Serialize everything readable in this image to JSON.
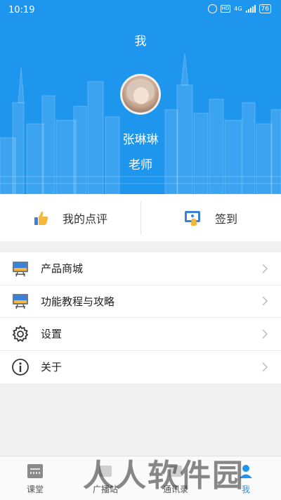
{
  "status_bar": {
    "time": "10:19",
    "hd": "HD",
    "network": "4G",
    "battery": "76"
  },
  "header": {
    "title": "我"
  },
  "profile": {
    "name": "张琳琳",
    "role": "老师"
  },
  "actions": [
    {
      "label": "我的点评",
      "icon": "thumbs-up-icon"
    },
    {
      "label": "签到",
      "icon": "checkin-icon"
    }
  ],
  "menu": [
    {
      "label": "产品商城",
      "icon": "monitor-icon"
    },
    {
      "label": "功能教程与攻略",
      "icon": "monitor-icon"
    },
    {
      "label": "设置",
      "icon": "gear-icon"
    },
    {
      "label": "关于",
      "icon": "info-icon"
    }
  ],
  "tabs": [
    {
      "label": "课堂",
      "icon": "classroom-icon"
    },
    {
      "label": "广播站",
      "icon": "broadcast-icon"
    },
    {
      "label": "通讯录",
      "icon": "contacts-icon"
    },
    {
      "label": "我",
      "icon": "me-icon",
      "active": true
    }
  ],
  "watermark": "人人软件园",
  "colors": {
    "primary": "#1e96ee",
    "thumb": "#f6b73c",
    "text": "#222222"
  }
}
